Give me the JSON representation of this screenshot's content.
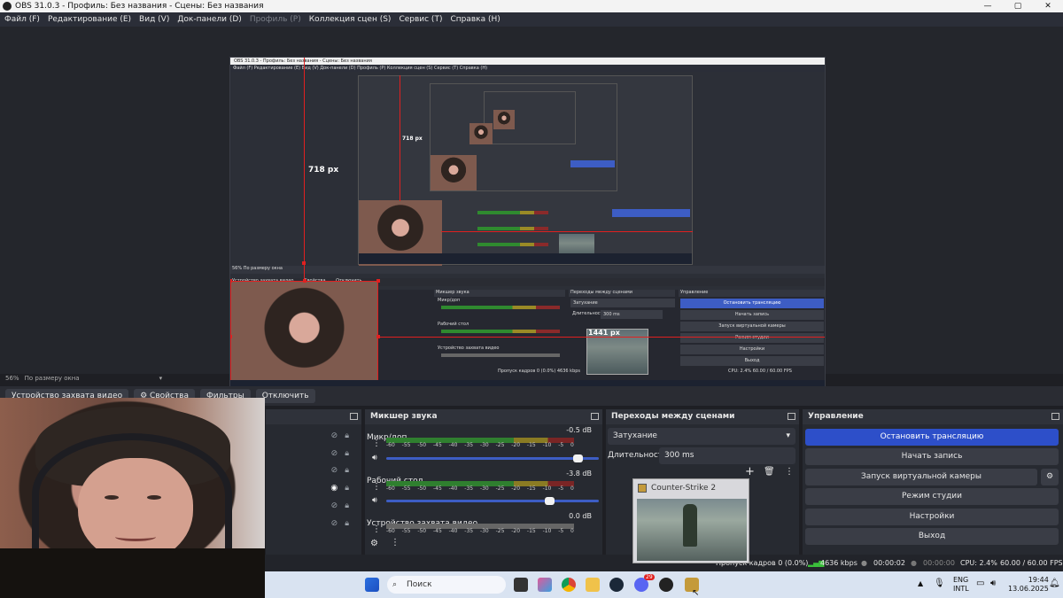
{
  "window": {
    "title": "OBS 31.0.3 - Профиль: Без названия - Сцены: Без названия",
    "controls": [
      "—",
      "▢",
      "✕"
    ]
  },
  "menu": [
    {
      "label": "Файл (F)",
      "enabled": true
    },
    {
      "label": "Редактирование (E)",
      "enabled": true
    },
    {
      "label": "Вид (V)",
      "enabled": true
    },
    {
      "label": "Док-панели (D)",
      "enabled": true
    },
    {
      "label": "Профиль (P)",
      "enabled": false
    },
    {
      "label": "Коллекция сцен (S)",
      "enabled": true
    },
    {
      "label": "Сервис (T)",
      "enabled": true
    },
    {
      "label": "Справка (H)",
      "enabled": true
    }
  ],
  "preview": {
    "measure_outer": "718 px",
    "measure_inner": "718 px",
    "measure_width": "1441 px",
    "nested_title": "OBS 31.0.3 - Профиль: Без названия - Сцены: Без названия",
    "nested_menu": "Файл (F)   Редактирование (E)   Вид (V)   Док-панели (D)   Профиль (P)   Коллекция сцен (S)   Сервис (T)   Справка (H)",
    "mini_mixer_title": "Микшер звука",
    "mini_transitions_title": "Переходы между сценами",
    "mini_controls_title": "Управление",
    "mini_ch1": "Микр/доп",
    "mini_ch2": "Рабочий стол",
    "mini_ch3": "Устройство захвата видео",
    "mini_fade": "Затухание",
    "mini_duration_label": "Длительность",
    "mini_duration": "300 ms",
    "mini_btn_stop": "Остановить трансляцию",
    "mini_btn_rec": "Начать запись",
    "mini_btn_vcam": "Запуск виртуальной камеры",
    "mini_btn_studio": "Режим студии",
    "mini_btn_settings": "Настройки",
    "mini_btn_exit": "Выход",
    "mini_toolbar_source": "Устройство захвата видео",
    "mini_toolbar_props": "Свойства",
    "mini_toolbar_off": "Отключить",
    "mini_zoom": "56%   По размеру окна",
    "mini_status": "Пропуск кадров 0 (0.0%)   4636 kbps",
    "mini_cpu": "CPU: 2.4%   60.00 / 60.00 FPS"
  },
  "zoom": {
    "percent": "56%",
    "mode": "По размеру окна"
  },
  "source_toolbar": {
    "source_name": "Устройство захвата видео",
    "properties": "Свойства",
    "filters": "Фильтры",
    "disable": "Отключить"
  },
  "mixer": {
    "title": "Микшер звука",
    "scale": [
      "-60",
      "-55",
      "-50",
      "-45",
      "-40",
      "-35",
      "-30",
      "-25",
      "-20",
      "-15",
      "-10",
      "-5",
      "0"
    ],
    "channels": [
      {
        "name": "Микр/доп",
        "db": "-0.5 dB",
        "volume": 0.92
      },
      {
        "name": "Рабочий стол",
        "db": "-3.8 dB",
        "volume": 0.78
      },
      {
        "name": "Устройство захвата видео",
        "db": "0.0 dB",
        "volume": 1.0
      }
    ]
  },
  "transitions": {
    "title": "Переходы между сценами",
    "selected": "Затухание",
    "duration_label": "Длительность",
    "duration": "300 ms",
    "popup_title": "Counter-Strike 2"
  },
  "controls": {
    "title": "Управление",
    "stop_stream": "Остановить трансляцию",
    "start_record": "Начать запись",
    "virtual_cam": "Запуск виртуальной камеры",
    "studio_mode": "Режим студии",
    "settings": "Настройки",
    "exit": "Выход"
  },
  "status": {
    "dropped": "Пропуск кадров 0 (0.0%)",
    "bitrate": "4636 kbps",
    "stream_time": "00:00:02",
    "record_time": "00:00:00",
    "cpu": "CPU: 2.4%",
    "fps": "60.00 / 60.00 FPS"
  },
  "taskbar": {
    "search_placeholder": "Поиск",
    "lang_top": "ENG",
    "lang_bottom": "INTL",
    "time": "19:44",
    "date": "13.06.2025",
    "notification_badge": "29"
  },
  "colors": {
    "accent": "#2d4fc9",
    "guide_red": "#e02020",
    "panel": "#272a31",
    "taskbar": "#d9e3f1"
  }
}
